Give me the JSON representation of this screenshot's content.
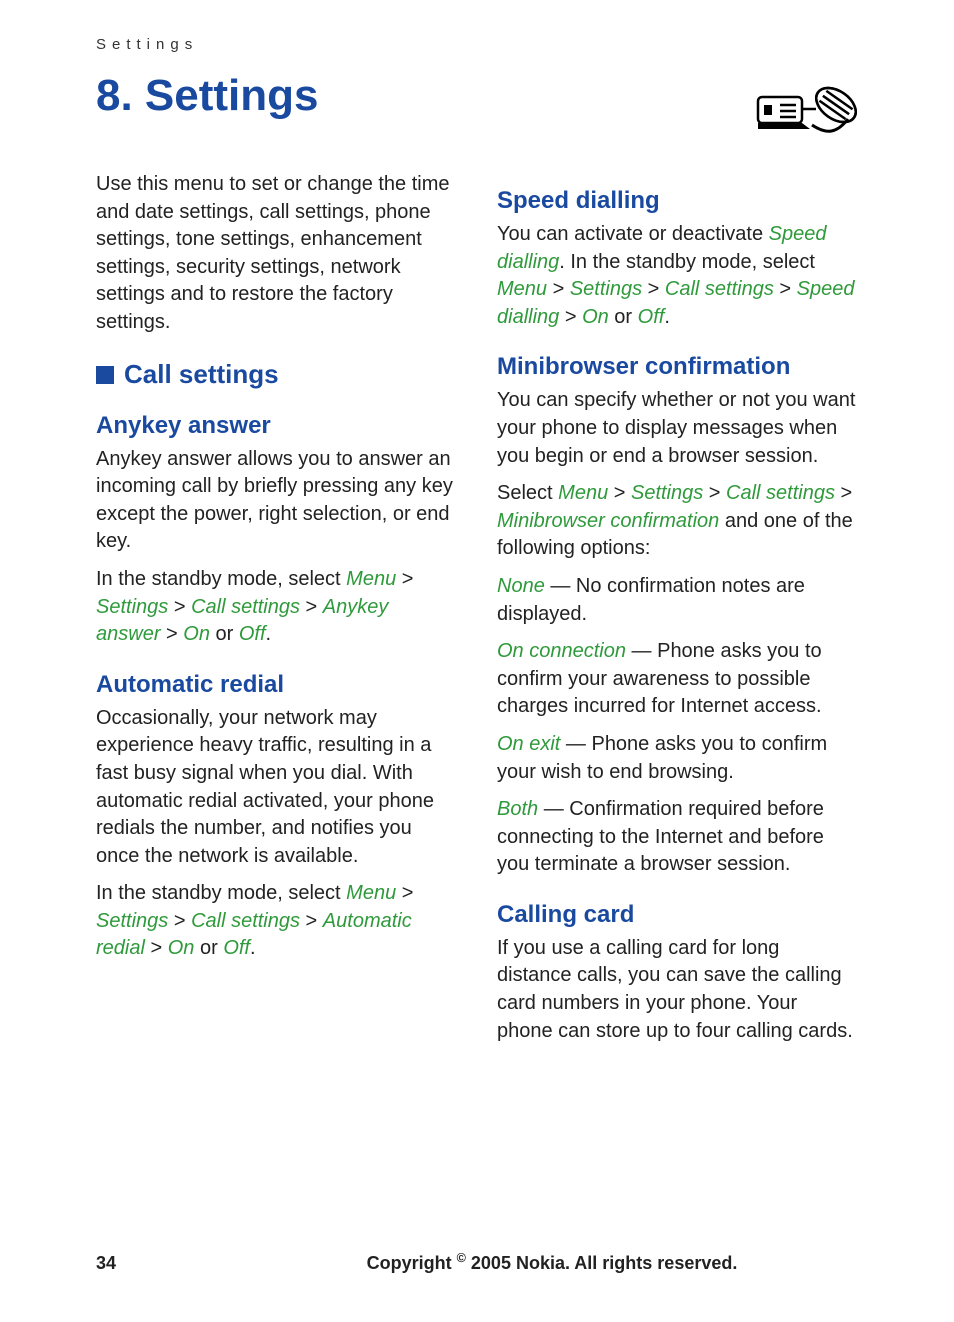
{
  "runningHeader": "Settings",
  "chapterTitle": "8. Settings",
  "intro": "Use this menu to set or change the time and date settings, call settings, phone settings, tone settings, enhancement settings, security settings, network settings and to restore the factory settings.",
  "sections": {
    "callSettings": {
      "title": "Call settings",
      "anykey": {
        "title": "Anykey answer",
        "p1": "Anykey answer allows you to answer an incoming call by briefly pressing any key except the power, right selection, or end key.",
        "p2_parts": {
          "lead": "In the standby mode, select ",
          "menu": "Menu",
          "gt1": " > ",
          "settings": "Settings",
          "gt2": " > ",
          "callSettings": "Call settings",
          "gt3": " > ",
          "anykeyAnswer": "Anykey answer",
          "gt4": " > ",
          "on": "On",
          "or": " or ",
          "off": "Off",
          "dot": "."
        }
      },
      "autoRedial": {
        "title": "Automatic redial",
        "p1": "Occasionally, your network may experience heavy traffic, resulting in a fast busy signal when you dial. With automatic redial activated, your phone redials the number, and notifies you once the network is available.",
        "p2_parts": {
          "lead": "In the standby mode, select ",
          "menu": "Menu",
          "gt1": " > ",
          "settings": "Settings",
          "gt2": " > ",
          "callSettings": "Call settings",
          "gt3": " > ",
          "autoRedial": "Automatic redial",
          "gt4": " > ",
          "on": "On",
          "or": " or ",
          "off": "Off",
          "dot": "."
        }
      },
      "speedDial": {
        "title": "Speed dialling",
        "p1_parts": {
          "lead": "You can activate or deactivate ",
          "speedDialling": "Speed dialling",
          "afterSD": ". In the standby mode, select ",
          "menu": "Menu",
          "gt1": " > ",
          "settings": "Settings",
          "gt2": " > ",
          "callSettings": "Call settings",
          "gt3": " > ",
          "speedDialling2": "Speed dialling",
          "gt4": " > ",
          "on": "On",
          "or": " or ",
          "off": "Off",
          "dot": "."
        }
      },
      "minibrowser": {
        "title": "Minibrowser confirmation",
        "p1": "You can specify whether or not you want your phone to display messages when you begin or end a browser session.",
        "p2_parts": {
          "lead": "Select ",
          "menu": "Menu",
          "gt1": " > ",
          "settings": "Settings",
          "gt2": " > ",
          "callSettings": "Call settings",
          "gt3": " > ",
          "miniConf": "Minibrowser confirmation",
          "tail": " and one of the following options:"
        },
        "opts": {
          "none": {
            "term": "None",
            "desc": " — No confirmation notes are displayed."
          },
          "onConn": {
            "term": "On connection",
            "desc": " — Phone asks you to confirm your awareness to possible charges incurred for Internet access."
          },
          "onExit": {
            "term": "On exit",
            "desc": " — Phone asks you to confirm your wish to end browsing."
          },
          "both": {
            "term": "Both",
            "desc": " — Confirmation required before connecting to the Internet and before you terminate a browser session."
          }
        }
      },
      "callingCard": {
        "title": "Calling card",
        "p1": "If you use a calling card for long distance calls, you can save the calling card numbers in your phone. Your phone can store up to four calling cards."
      }
    }
  },
  "footer": {
    "pageNumber": "34",
    "copyrightPrefix": "Copyright ",
    "copyrightSym": "©",
    "copyrightSuffix": " 2005 Nokia. All rights reserved."
  }
}
